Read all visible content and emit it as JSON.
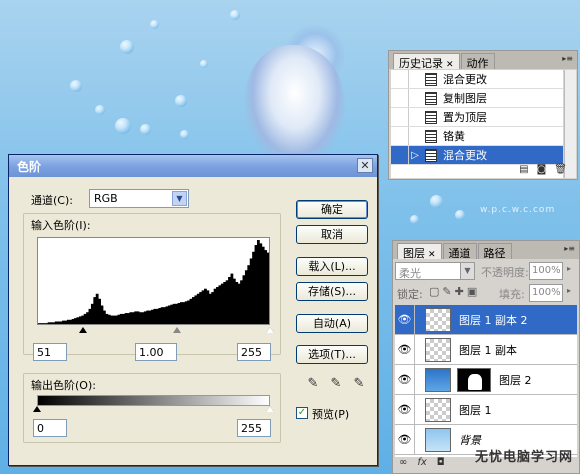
{
  "levels_dialog": {
    "title": "色阶",
    "close_glyph": "✕",
    "channel_label": "通道(C):",
    "channel_value": "RGB",
    "input_levels_label": "输入色阶(I):",
    "input_black": "51",
    "input_gamma": "1.00",
    "input_white": "255",
    "output_levels_label": "输出色阶(O):",
    "output_black": "0",
    "output_white": "255",
    "buttons": {
      "ok": "确定",
      "cancel": "取消",
      "load": "载入(L)...",
      "save": "存储(S)...",
      "auto": "自动(A)",
      "options": "选项(T)..."
    },
    "preview_label": "预览(P)",
    "preview_checked": true,
    "histogram": [
      1,
      1,
      1,
      1,
      2,
      2,
      2,
      3,
      3,
      3,
      4,
      4,
      5,
      5,
      6,
      7,
      8,
      9,
      10,
      12,
      14,
      18,
      24,
      32,
      36,
      30,
      22,
      16,
      12,
      11,
      10,
      10,
      10,
      11,
      12,
      12,
      13,
      13,
      14,
      14,
      15,
      15,
      14,
      14,
      15,
      16,
      16,
      17,
      18,
      18,
      19,
      20,
      20,
      21,
      22,
      23,
      24,
      24,
      25,
      26,
      26,
      27,
      28,
      30,
      32,
      34,
      36,
      38,
      40,
      42,
      40,
      36,
      38,
      42,
      44,
      46,
      48,
      50,
      52,
      56,
      60,
      54,
      50,
      48,
      52,
      58,
      64,
      70,
      78,
      86,
      94,
      100,
      96,
      92,
      88,
      85
    ]
  },
  "history_panel": {
    "tabs": [
      "历史记录",
      "动作"
    ],
    "items": [
      {
        "label": "混合更改",
        "selected": false
      },
      {
        "label": "复制图层",
        "selected": false
      },
      {
        "label": "置为顶层",
        "selected": false
      },
      {
        "label": "铬黄",
        "selected": false
      },
      {
        "label": "混合更改",
        "selected": true
      }
    ]
  },
  "layers_panel": {
    "tabs": [
      "图层",
      "通道",
      "路径"
    ],
    "blend_mode": "柔光",
    "opacity_label": "不透明度:",
    "opacity_value": "100%",
    "lock_label": "锁定:",
    "fill_label": "填充:",
    "fill_value": "100%",
    "layers": [
      {
        "name": "图层 1 副本 2",
        "selected": true,
        "thumb": "check"
      },
      {
        "name": "图层 1 副本",
        "selected": false,
        "thumb": "check"
      },
      {
        "name": "图层 2",
        "selected": false,
        "thumb": "blue"
      },
      {
        "name": "图层 1",
        "selected": false,
        "thumb": "check"
      },
      {
        "name": "背景",
        "selected": false,
        "thumb": "sky"
      }
    ]
  },
  "watermark": {
    "text": "无忧电脑学习网",
    "url": "w.p.c.w.c.com"
  }
}
